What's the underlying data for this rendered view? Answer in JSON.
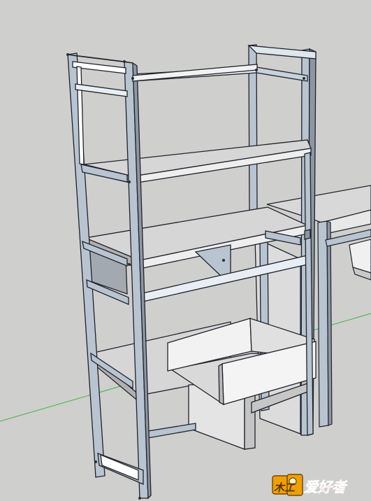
{
  "scene": {
    "background_color": "#cfcfcd",
    "frame_color": "#b8c4d0",
    "frame_stroke": "#1f232a",
    "shelf_color": "#d6d6d6",
    "panel_color": "#e9e9e9",
    "axis_green": "#3fb244"
  },
  "watermark": {
    "char_wood": "木工",
    "text": "爱好者",
    "primary_color": "#e21e1e",
    "secondary_color": "#f0a000"
  }
}
